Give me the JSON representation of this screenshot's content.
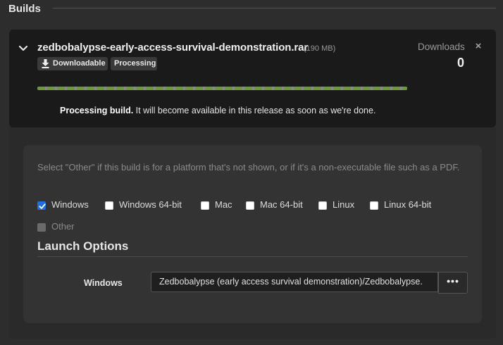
{
  "section": {
    "title": "Builds"
  },
  "build": {
    "filename": "zedbobalypse-early-access-survival-demonstration.rar",
    "size": "(190 MB)",
    "tags": {
      "downloadable": "Downloadable",
      "processing": "Processing"
    },
    "progress": 1.0,
    "status_bold": "Processing build.",
    "status_rest": " It will become available in this release as soon as we're done.",
    "downloads_label": "Downloads",
    "downloads_value": "0",
    "close_symbol": "×",
    "icons": {
      "expand": "chevron-down-icon",
      "download": "download-icon",
      "close": "close-icon"
    },
    "colors": {
      "progress": "#6b9a36",
      "card_bg": "#1a1a1a"
    }
  },
  "platforms": {
    "hint": "Select \"Other\" if this build is for a platform that's not shown, or if it's a non-executable file such as a PDF.",
    "items": [
      {
        "label": "Windows",
        "checked": true
      },
      {
        "label": "Windows 64-bit",
        "checked": false
      },
      {
        "label": "Mac",
        "checked": false
      },
      {
        "label": "Mac 64-bit",
        "checked": false
      },
      {
        "label": "Linux",
        "checked": false
      },
      {
        "label": "Linux 64-bit",
        "checked": false
      },
      {
        "label": "Other",
        "checked": false,
        "disabled": true
      }
    ],
    "check_color": "#1f6fdc"
  },
  "launch": {
    "title": "Launch Options",
    "platform_label": "Windows",
    "path_value": "Zedbobalypse (early access survival demonstration)/Zedbobalypse.",
    "more_label": "•••"
  }
}
